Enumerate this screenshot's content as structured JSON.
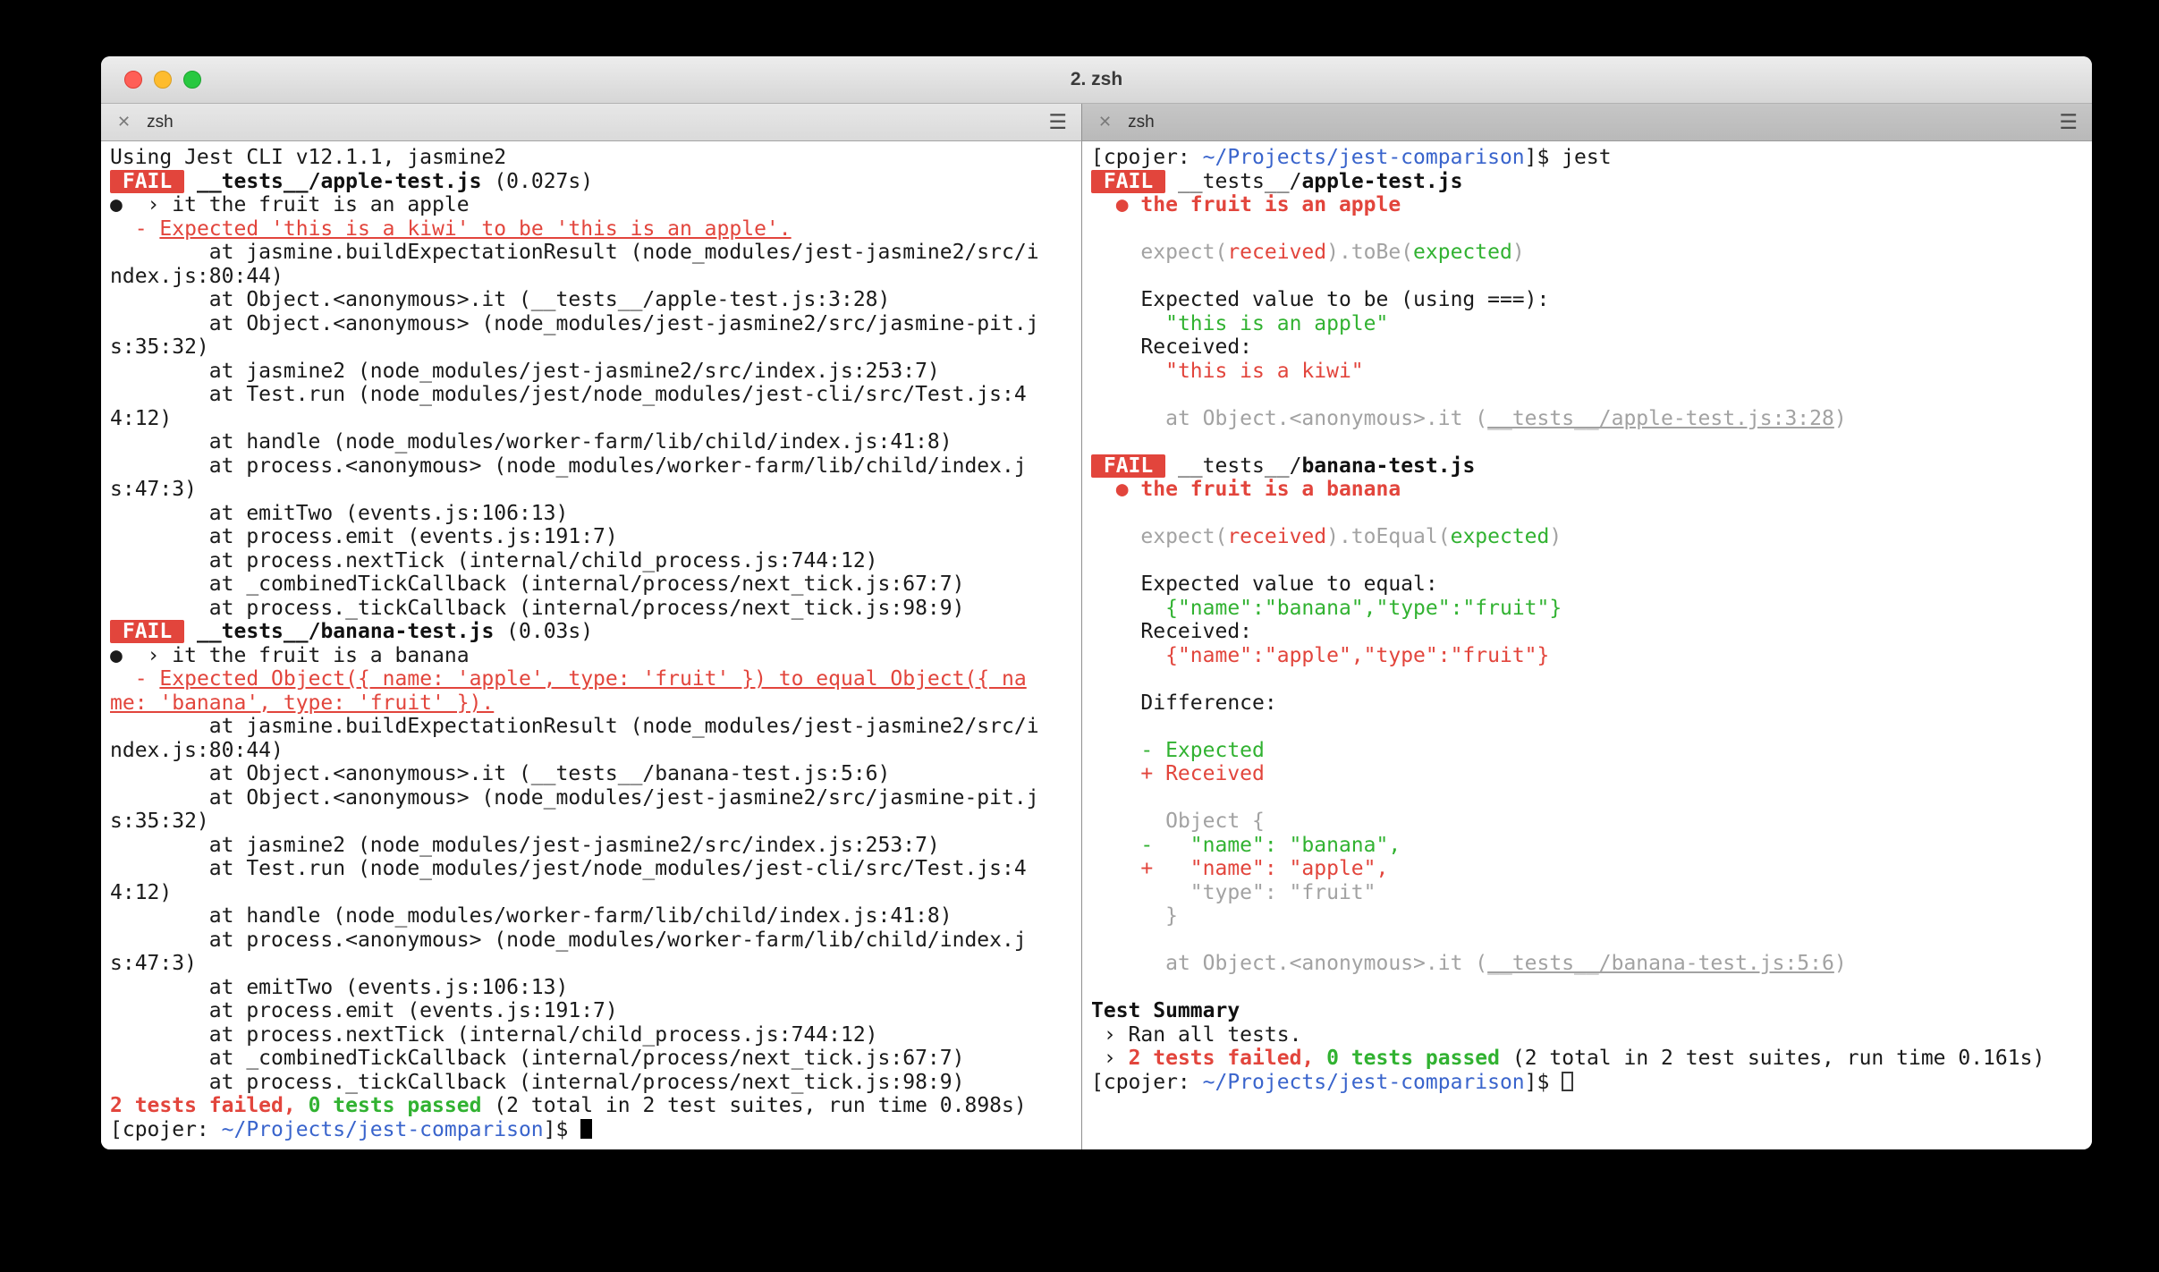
{
  "window": {
    "title": "2. zsh"
  },
  "icons": {
    "close": "✕",
    "menu": "☰"
  },
  "colors": {
    "badge": "#e2453c",
    "red": "#e2453c",
    "green": "#31b231",
    "blue": "#3964cc",
    "gray": "#a2a2a2",
    "traffic-close": "#ff5f57",
    "traffic-minimize": "#febc2e",
    "traffic-zoom": "#28c840"
  },
  "tabs": {
    "left": {
      "label": "zsh"
    },
    "right": {
      "label": "zsh"
    }
  },
  "panes": {
    "left": {
      "lines": [
        [
          {
            "t": "Using Jest CLI v12.1.1, jasmine2",
            "s": "default"
          }
        ],
        [
          {
            "t": " FAIL ",
            "s": "badge"
          },
          {
            "t": " ",
            "s": "default"
          },
          {
            "t": "__tests__/apple-test.js",
            "s": "bold"
          },
          {
            "t": " (0.027s)",
            "s": "default"
          }
        ],
        [
          {
            "t": "●  › it the fruit is an apple",
            "s": "default"
          }
        ],
        [
          {
            "t": "  - ",
            "s": "red"
          },
          {
            "t": "Expected 'this is a kiwi' to be 'this is an apple'.",
            "s": "red-underline"
          }
        ],
        [
          {
            "t": "        at jasmine.buildExpectationResult (node_modules/jest-jasmine2/src/index.js:80:44)",
            "s": "default"
          }
        ],
        [
          {
            "t": "        at Object.<anonymous>.it (__tests__/apple-test.js:3:28)",
            "s": "default"
          }
        ],
        [
          {
            "t": "        at Object.<anonymous> (node_modules/jest-jasmine2/src/jasmine-pit.js:35:32)",
            "s": "default"
          }
        ],
        [
          {
            "t": "        at jasmine2 (node_modules/jest-jasmine2/src/index.js:253:7)",
            "s": "default"
          }
        ],
        [
          {
            "t": "        at Test.run (node_modules/jest/node_modules/jest-cli/src/Test.js:44:12)",
            "s": "default"
          }
        ],
        [
          {
            "t": "        at handle (node_modules/worker-farm/lib/child/index.js:41:8)",
            "s": "default"
          }
        ],
        [
          {
            "t": "        at process.<anonymous> (node_modules/worker-farm/lib/child/index.js:47:3)",
            "s": "default"
          }
        ],
        [
          {
            "t": "        at emitTwo (events.js:106:13)",
            "s": "default"
          }
        ],
        [
          {
            "t": "        at process.emit (events.js:191:7)",
            "s": "default"
          }
        ],
        [
          {
            "t": "        at process.nextTick (internal/child_process.js:744:12)",
            "s": "default"
          }
        ],
        [
          {
            "t": "        at _combinedTickCallback (internal/process/next_tick.js:67:7)",
            "s": "default"
          }
        ],
        [
          {
            "t": "        at process._tickCallback (internal/process/next_tick.js:98:9)",
            "s": "default"
          }
        ],
        [
          {
            "t": " FAIL ",
            "s": "badge"
          },
          {
            "t": " ",
            "s": "default"
          },
          {
            "t": "__tests__/banana-test.js",
            "s": "bold"
          },
          {
            "t": " (0.03s)",
            "s": "default"
          }
        ],
        [
          {
            "t": "●  › it the fruit is a banana",
            "s": "default"
          }
        ],
        [
          {
            "t": "  - ",
            "s": "red"
          },
          {
            "t": "Expected Object({ name: 'apple', type: 'fruit' }) to equal Object({ name: 'banana', type: 'fruit' }).",
            "s": "red-underline"
          }
        ],
        [
          {
            "t": "        at jasmine.buildExpectationResult (node_modules/jest-jasmine2/src/index.js:80:44)",
            "s": "default"
          }
        ],
        [
          {
            "t": "        at Object.<anonymous>.it (__tests__/banana-test.js:5:6)",
            "s": "default"
          }
        ],
        [
          {
            "t": "        at Object.<anonymous> (node_modules/jest-jasmine2/src/jasmine-pit.js:35:32)",
            "s": "default"
          }
        ],
        [
          {
            "t": "        at jasmine2 (node_modules/jest-jasmine2/src/index.js:253:7)",
            "s": "default"
          }
        ],
        [
          {
            "t": "        at Test.run (node_modules/jest/node_modules/jest-cli/src/Test.js:44:12)",
            "s": "default"
          }
        ],
        [
          {
            "t": "        at handle (node_modules/worker-farm/lib/child/index.js:41:8)",
            "s": "default"
          }
        ],
        [
          {
            "t": "        at process.<anonymous> (node_modules/worker-farm/lib/child/index.js:47:3)",
            "s": "default"
          }
        ],
        [
          {
            "t": "        at emitTwo (events.js:106:13)",
            "s": "default"
          }
        ],
        [
          {
            "t": "        at process.emit (events.js:191:7)",
            "s": "default"
          }
        ],
        [
          {
            "t": "        at process.nextTick (internal/child_process.js:744:12)",
            "s": "default"
          }
        ],
        [
          {
            "t": "        at _combinedTickCallback (internal/process/next_tick.js:67:7)",
            "s": "default"
          }
        ],
        [
          {
            "t": "        at process._tickCallback (internal/process/next_tick.js:98:9)",
            "s": "default"
          }
        ],
        [
          {
            "t": "2 tests failed,",
            "s": "red-bold"
          },
          {
            "t": " ",
            "s": "default"
          },
          {
            "t": "0 tests passed",
            "s": "green-bold"
          },
          {
            "t": " (2 total in 2 test suites, run time 0.898s)",
            "s": "default"
          }
        ],
        [
          {
            "t": "[cpojer: ",
            "s": "default"
          },
          {
            "t": "~/Projects/jest-comparison",
            "s": "blue"
          },
          {
            "t": "]$ ",
            "s": "default"
          },
          {
            "t": "",
            "s": "cursor-block"
          }
        ]
      ]
    },
    "right": {
      "lines": [
        [
          {
            "t": "[cpojer: ",
            "s": "default"
          },
          {
            "t": "~/Projects/jest-comparison",
            "s": "blue"
          },
          {
            "t": "]$ jest",
            "s": "default"
          }
        ],
        [
          {
            "t": " FAIL ",
            "s": "badge"
          },
          {
            "t": " __tests__/",
            "s": "default"
          },
          {
            "t": "apple-test.js",
            "s": "bold"
          }
        ],
        [
          {
            "t": "  ● the fruit is an apple",
            "s": "red-bold"
          }
        ],
        [],
        [
          {
            "t": "    expect(",
            "s": "gray"
          },
          {
            "t": "received",
            "s": "red"
          },
          {
            "t": ").toBe(",
            "s": "gray"
          },
          {
            "t": "expected",
            "s": "green"
          },
          {
            "t": ")",
            "s": "gray"
          }
        ],
        [],
        [
          {
            "t": "    Expected value to be (using ===):",
            "s": "default"
          }
        ],
        [
          {
            "t": "      \"this is an apple\"",
            "s": "green"
          }
        ],
        [
          {
            "t": "    Received:",
            "s": "default"
          }
        ],
        [
          {
            "t": "      \"this is a kiwi\"",
            "s": "red"
          }
        ],
        [],
        [
          {
            "t": "      at Object.<anonymous>.it (",
            "s": "gray"
          },
          {
            "t": "__tests__/apple-test.js:3:28",
            "s": "gray-underline"
          },
          {
            "t": ")",
            "s": "gray"
          }
        ],
        [],
        [
          {
            "t": " FAIL ",
            "s": "badge"
          },
          {
            "t": " __tests__/",
            "s": "default"
          },
          {
            "t": "banana-test.js",
            "s": "bold"
          }
        ],
        [
          {
            "t": "  ● the fruit is a banana",
            "s": "red-bold"
          }
        ],
        [],
        [
          {
            "t": "    expect(",
            "s": "gray"
          },
          {
            "t": "received",
            "s": "red"
          },
          {
            "t": ").toEqual(",
            "s": "gray"
          },
          {
            "t": "expected",
            "s": "green"
          },
          {
            "t": ")",
            "s": "gray"
          }
        ],
        [],
        [
          {
            "t": "    Expected value to equal:",
            "s": "default"
          }
        ],
        [
          {
            "t": "      {\"name\":\"banana\",\"type\":\"fruit\"}",
            "s": "green"
          }
        ],
        [
          {
            "t": "    Received:",
            "s": "default"
          }
        ],
        [
          {
            "t": "      {\"name\":\"apple\",\"type\":\"fruit\"}",
            "s": "red"
          }
        ],
        [],
        [
          {
            "t": "    Difference:",
            "s": "default"
          }
        ],
        [],
        [
          {
            "t": "    - Expected",
            "s": "green"
          }
        ],
        [
          {
            "t": "    + Received",
            "s": "red"
          }
        ],
        [],
        [
          {
            "t": "      Object {",
            "s": "gray"
          }
        ],
        [
          {
            "t": "    -   \"name\": \"banana\",",
            "s": "green"
          }
        ],
        [
          {
            "t": "    +   \"name\": \"apple\",",
            "s": "red"
          }
        ],
        [
          {
            "t": "        \"type\": \"fruit\"",
            "s": "gray"
          }
        ],
        [
          {
            "t": "      }",
            "s": "gray"
          }
        ],
        [],
        [
          {
            "t": "      at Object.<anonymous>.it (",
            "s": "gray"
          },
          {
            "t": "__tests__/banana-test.js:5:6",
            "s": "gray-underline"
          },
          {
            "t": ")",
            "s": "gray"
          }
        ],
        [],
        [
          {
            "t": "Test Summary",
            "s": "bold"
          }
        ],
        [
          {
            "t": " › Ran all tests.",
            "s": "default"
          }
        ],
        [
          {
            "t": " › ",
            "s": "default"
          },
          {
            "t": "2 tests failed,",
            "s": "red-bold"
          },
          {
            "t": " ",
            "s": "default"
          },
          {
            "t": "0 tests passed",
            "s": "green-bold"
          },
          {
            "t": " (2 total in 2 test suites, run time 0.161s)",
            "s": "default"
          }
        ],
        [
          {
            "t": "[cpojer: ",
            "s": "default"
          },
          {
            "t": "~/Projects/jest-comparison",
            "s": "blue"
          },
          {
            "t": "]$ ",
            "s": "default"
          },
          {
            "t": "",
            "s": "cursor-outline"
          }
        ]
      ]
    }
  }
}
